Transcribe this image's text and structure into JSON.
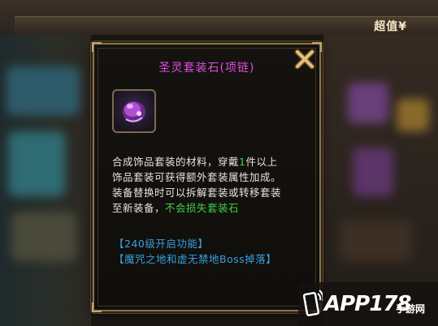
{
  "background": {
    "top_label": "超值¥"
  },
  "popup": {
    "title": "圣灵套装石(项链)",
    "item_icon": "purple-gem-necklace-icon",
    "description": {
      "line1_pre": "合成饰品套装的材料，穿戴",
      "line1_qty": "1",
      "line1_post": "件以上",
      "line2": "饰品套装可获得额外套装属性加成。",
      "line3": "装备替换时可以拆解套装或转移套装",
      "line4_pre": "至新装备，",
      "line4_green": "不会损失套装石"
    },
    "unlock_level": "【240级开启功能】",
    "drop_source": "【魔咒之地和虚无禁地Boss掉落】",
    "colors": {
      "title": "#e04de0",
      "highlight_green": "#3fd24a",
      "info_blue": "#3aa0e0"
    }
  },
  "watermark": {
    "logo": "APP178",
    "suffix": "手游网"
  }
}
